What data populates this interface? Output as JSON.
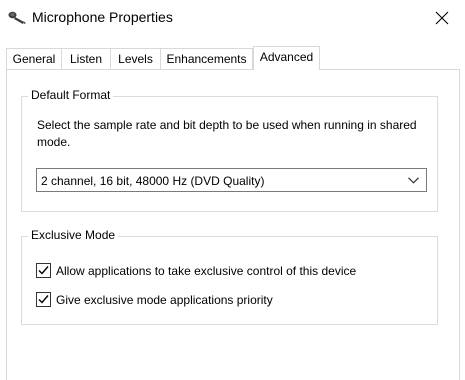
{
  "window": {
    "title": "Microphone Properties"
  },
  "tabs": [
    {
      "label": "General"
    },
    {
      "label": "Listen"
    },
    {
      "label": "Levels"
    },
    {
      "label": "Enhancements"
    },
    {
      "label": "Advanced"
    }
  ],
  "active_tab": "Advanced",
  "default_format": {
    "legend": "Default Format",
    "description": "Select the sample rate and bit depth to be used when running in shared mode.",
    "selected_format": "2 channel, 16 bit, 48000 Hz (DVD Quality)"
  },
  "exclusive_mode": {
    "legend": "Exclusive Mode",
    "options": [
      {
        "label": "Allow applications to take exclusive control of this device",
        "checked": true
      },
      {
        "label": "Give exclusive mode applications priority",
        "checked": true
      }
    ]
  },
  "icons": {
    "title": "microphone-icon",
    "close": "close-icon",
    "dropdown": "chevron-down-icon",
    "check": "checkmark-icon"
  }
}
